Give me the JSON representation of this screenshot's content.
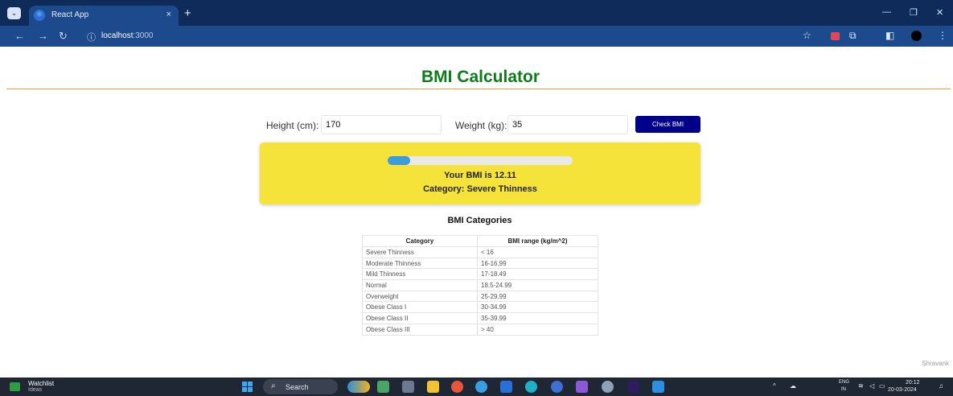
{
  "browser": {
    "tab_title": "React App",
    "tab_close": "×",
    "new_tab": "+",
    "url_host": "localhost",
    "url_port": ":3000",
    "window_minimize": "—",
    "window_restore": "❐",
    "window_close": "✕"
  },
  "page": {
    "title": "BMI Calculator",
    "height_label": "Height (cm):",
    "height_value": "170",
    "weight_label": "Weight (kg):",
    "weight_value": "35",
    "check_button": "Check BMI",
    "result": {
      "bmi_text": "Your BMI is 12.11",
      "category_text": "Category: Severe Thinness",
      "progress_fraction": 0.12,
      "bar_color": "#3b9ddd",
      "box_color": "#f5e33a"
    },
    "categories_heading": "BMI Categories",
    "table": {
      "headers": [
        "Category",
        "BMI range (kg/m^2)"
      ],
      "rows": [
        [
          "Severe Thinness",
          "< 16"
        ],
        [
          "Moderate Thinness",
          "16-16.99"
        ],
        [
          "Mild Thinness",
          "17-18.49"
        ],
        [
          "Normal",
          "18.5-24.99"
        ],
        [
          "Overweight",
          "25-29.99"
        ],
        [
          "Obese Class I",
          "30-34.99"
        ],
        [
          "Obese Class II",
          "35-39.99"
        ],
        [
          "Obese Class III",
          "> 40"
        ]
      ]
    },
    "watermark": "Shravank",
    "accent_color": "#0d7d1c"
  },
  "taskbar": {
    "widget_title": "Watchlist",
    "widget_subtitle": "Ideas",
    "search_label": "Search",
    "lang_line1": "ENG",
    "lang_line2": "IN",
    "time": "20:12",
    "date": "20-03-2024"
  }
}
